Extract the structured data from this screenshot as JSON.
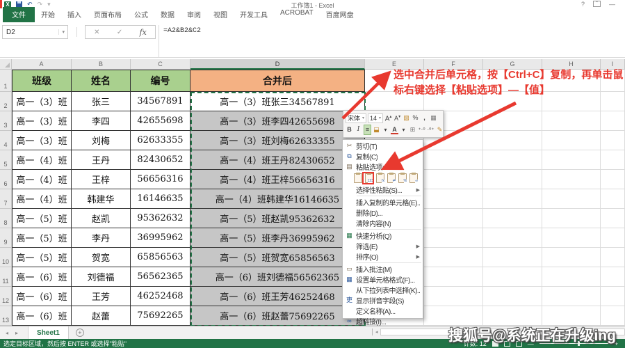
{
  "colors": {
    "excel_green": "#217346",
    "table_header_green": "#a9d08e",
    "table_header_orange": "#f4b183",
    "selection_gray": "#c6c6c6",
    "annotation_red": "#e8392f"
  },
  "titlebar": {
    "title": "工作簿1 - Excel",
    "help": "?",
    "minimize": "—",
    "qat": {
      "undo": "↶",
      "redo": "↷"
    }
  },
  "ribbon": {
    "file_tab": "文件",
    "tabs": [
      "开始",
      "插入",
      "页面布局",
      "公式",
      "数据",
      "审阅",
      "视图",
      "开发工具",
      "ACROBAT",
      "百度网盘"
    ]
  },
  "formula_bar": {
    "name_box": "D2",
    "cancel": "✕",
    "enter": "✓",
    "fx": "fx",
    "formula": "=A2&B2&C2"
  },
  "sheet": {
    "col_headers": [
      "A",
      "B",
      "C",
      "D",
      "E",
      "F",
      "G",
      "H",
      "I"
    ],
    "selected_col": "D",
    "row_headers": [
      "1",
      "2",
      "3",
      "4",
      "5",
      "6",
      "7",
      "8",
      "9",
      "10",
      "11",
      "12",
      "13"
    ],
    "table": {
      "headers": [
        "班级",
        "姓名",
        "编号",
        "合并后"
      ],
      "rows": [
        [
          "高一（3）班",
          "张三",
          "34567891",
          "高一（3）班张三34567891"
        ],
        [
          "高一（3）班",
          "李四",
          "42655698",
          "高一（3）班李四42655698"
        ],
        [
          "高一（3）班",
          "刘梅",
          "62633355",
          "高一（3）班刘梅62633355"
        ],
        [
          "高一（4）班",
          "王丹",
          "82430652",
          "高一（4）班王丹82430652"
        ],
        [
          "高一（4）班",
          "王梓",
          "56656316",
          "高一（4）班王梓56656316"
        ],
        [
          "高一（4）班",
          "韩建华",
          "16146635",
          "高一（4）班韩建华16146635"
        ],
        [
          "高一（5）班",
          "赵凯",
          "95362632",
          "高一（5）班赵凯95362632"
        ],
        [
          "高一（5）班",
          "李丹",
          "36995962",
          "高一（5）班李丹36995962"
        ],
        [
          "高一（5）班",
          "贺宽",
          "65856563",
          "高一（5）班贺宽65856563"
        ],
        [
          "高一（6）班",
          "刘德福",
          "56562365",
          "高一（6）班刘德福56562365"
        ],
        [
          "高一（6）班",
          "王芳",
          "46252468",
          "高一（6）班王芳46252468"
        ],
        [
          "高一（6）班",
          "赵蕾",
          "75692265",
          "高一（6）班赵蕾75692265"
        ]
      ]
    }
  },
  "annotation": {
    "text": "选中合并后单元格，按【Ctrl+C】复制，再单击鼠标右键选择【粘贴选项】—【值】"
  },
  "mini_toolbar": {
    "font_name": "宋体",
    "font_size": "14",
    "row1_icons": [
      "grow-font-icon",
      "shrink-font-icon",
      "format-painter-icon",
      "percent-style-icon",
      "comma-style-icon",
      "format-as-table-icon"
    ],
    "row2_icons": [
      "bold-icon",
      "italic-icon",
      "center-align-icon",
      "fill-color-icon",
      "font-color-icon",
      "borders-icon",
      "increase-decimal-icon",
      "decrease-decimal-icon",
      "brush-icon"
    ]
  },
  "context_menu": {
    "items": [
      {
        "id": "cut",
        "label": "剪切(T)",
        "icon": "scissors-icon"
      },
      {
        "id": "copy",
        "label": "复制(C)",
        "icon": "copy-icon"
      },
      {
        "id": "paste-options",
        "label": "粘贴选项:",
        "icon": "clipboard-icon"
      },
      {
        "id": "paste-icons-row",
        "type": "icons"
      },
      {
        "id": "paste-special",
        "label": "选择性粘贴(S)...",
        "arrow": true,
        "sep_after": true
      },
      {
        "id": "insert-copied-cells",
        "label": "插入复制的单元格(E)..."
      },
      {
        "id": "delete",
        "label": "删除(D)..."
      },
      {
        "id": "clear-contents",
        "label": "清除内容(N)",
        "sep_after": true
      },
      {
        "id": "quick-analysis",
        "label": "快速分析(Q)",
        "icon": "quick-analysis-icon"
      },
      {
        "id": "filter",
        "label": "筛选(E)",
        "arrow": true
      },
      {
        "id": "sort",
        "label": "排序(O)",
        "arrow": true,
        "sep_after": true
      },
      {
        "id": "insert-comment",
        "label": "插入批注(M)",
        "icon": "comment-icon"
      },
      {
        "id": "format-cells",
        "label": "设置单元格格式(F)...",
        "icon": "format-cells-icon"
      },
      {
        "id": "pick-from-list",
        "label": "从下拉列表中选择(K)..."
      },
      {
        "id": "show-phonetic",
        "label": "显示拼音字段(S)",
        "icon": "phonetic-icon"
      },
      {
        "id": "define-name",
        "label": "定义名称(A)..."
      },
      {
        "id": "hyperlink",
        "label": "超链接(I)...",
        "icon": "hyperlink-icon"
      }
    ],
    "paste_icons": [
      {
        "id": "paste",
        "label": "粘贴"
      },
      {
        "id": "paste-values",
        "label": "值",
        "highlighted": true,
        "tag": "123"
      },
      {
        "id": "paste-formulas",
        "label": "公式",
        "tag": "fx"
      },
      {
        "id": "paste-transpose",
        "label": "转置",
        "tag": "⇄"
      },
      {
        "id": "paste-formatting",
        "label": "格式",
        "tag": "%"
      },
      {
        "id": "paste-link",
        "label": "粘贴链接",
        "tag": "∞"
      }
    ]
  },
  "sheet_tabs": {
    "active": "Sheet1",
    "add": "+",
    "nav_left": "◂",
    "nav_right": "▸"
  },
  "status_bar": {
    "left": "选定目标区域，然后按 ENTER 或选择\"粘贴\"",
    "count": "计数: 12",
    "zoom_minus": "—",
    "zoom_plus": "+"
  },
  "watermark": "搜狐号@系统正在升级ing"
}
